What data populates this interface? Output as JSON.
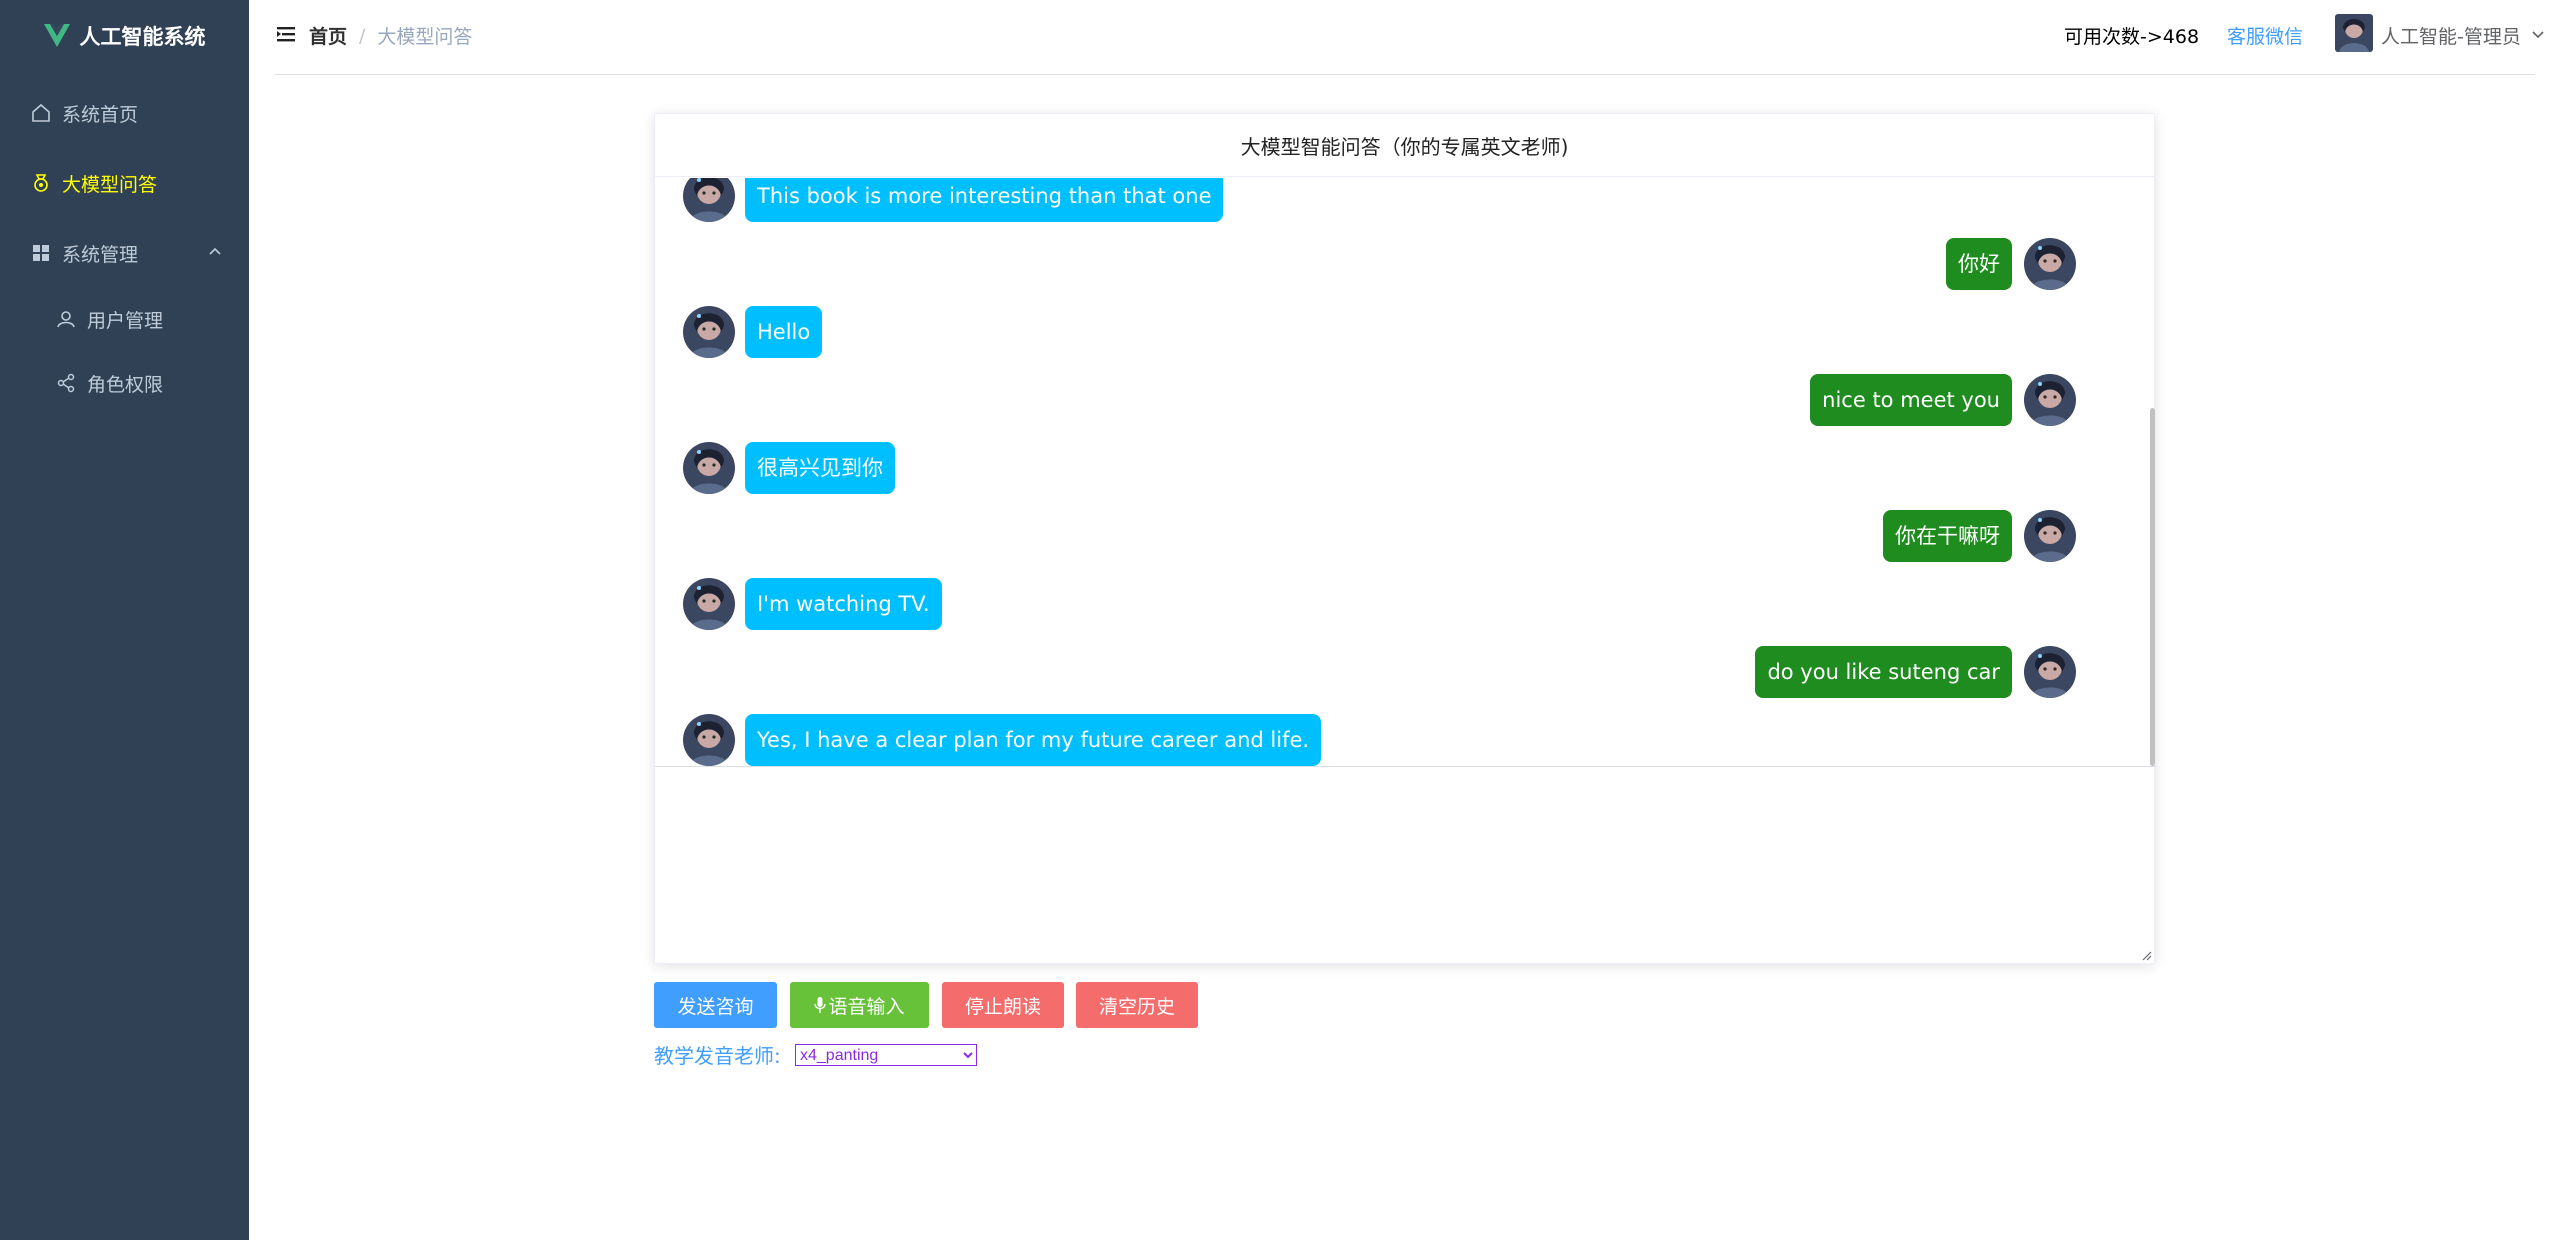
{
  "app": {
    "logo_text": "人工智能系统",
    "accent": "#ffff00",
    "sidebar_bg": "#304156"
  },
  "sidebar": {
    "items": [
      {
        "label": "系统首页",
        "icon": "home-icon"
      },
      {
        "label": "大模型问答",
        "icon": "medal-icon",
        "active": true
      },
      {
        "label": "系统管理",
        "icon": "grid-icon"
      },
      {
        "label": "用户管理",
        "icon": "user-icon"
      },
      {
        "label": "角色权限",
        "icon": "share-icon"
      }
    ]
  },
  "header": {
    "breadcrumb_home": "首页",
    "breadcrumb_sep": "/",
    "breadcrumb_current": "大模型问答",
    "count_text": "可用次数->468",
    "service_link": "客服微信",
    "username": "人工智能-管理员"
  },
  "chat": {
    "title": "大模型智能问答（你的专属英文老师)",
    "messages": [
      {
        "role": "bot",
        "text": "This book is more interesting than that one"
      },
      {
        "role": "user",
        "text": "你好"
      },
      {
        "role": "bot",
        "text": "Hello"
      },
      {
        "role": "user",
        "text": "nice to meet you"
      },
      {
        "role": "bot",
        "text": "很高兴见到你"
      },
      {
        "role": "user",
        "text": "你在干嘛呀"
      },
      {
        "role": "bot",
        "text": "I'm watching TV."
      },
      {
        "role": "user",
        "text": "do you like suteng car"
      },
      {
        "role": "bot",
        "text": "Yes, I have a clear plan for my future career and life."
      }
    ],
    "input_value": ""
  },
  "buttons": {
    "send": "发送咨询",
    "voice": "语音输入",
    "stop": "停止朗读",
    "clear": "清空历史"
  },
  "teacher": {
    "label": "教学发音老师:",
    "selected": "x4_panting"
  }
}
